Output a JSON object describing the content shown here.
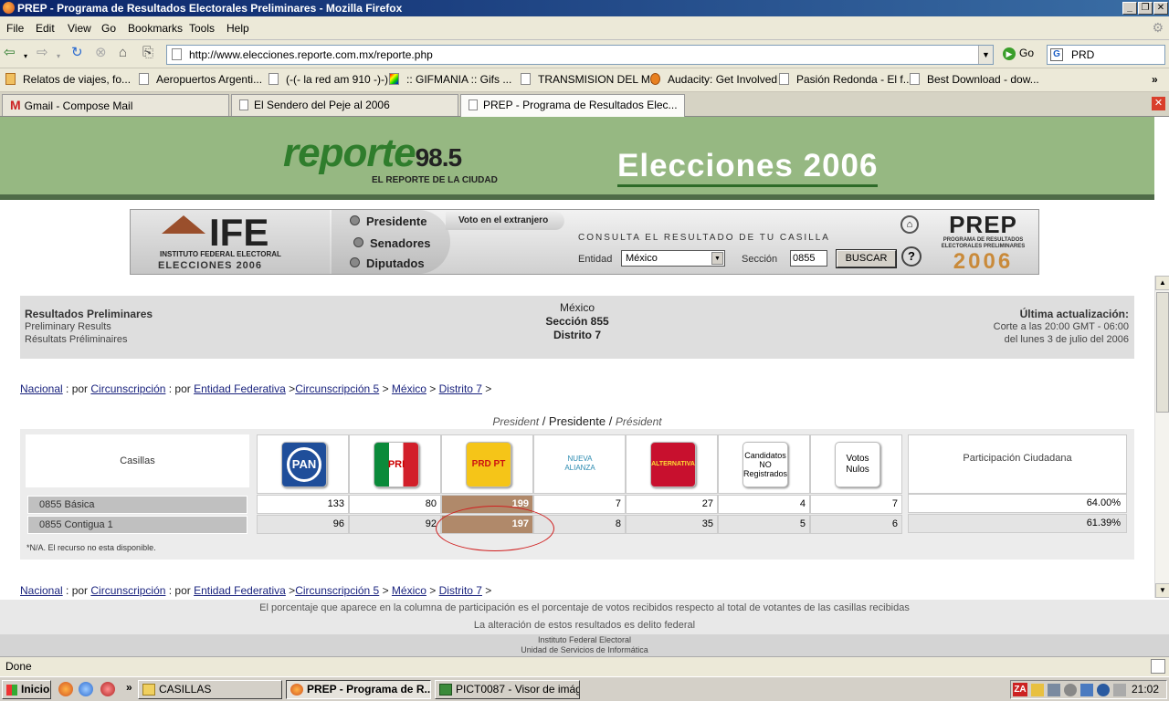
{
  "window": {
    "title": "PREP - Programa de Resultados Electorales Preliminares - Mozilla Firefox"
  },
  "menu": [
    "File",
    "Edit",
    "View",
    "Go",
    "Bookmarks",
    "Tools",
    "Help"
  ],
  "nav": {
    "url": "http://www.elecciones.reporte.com.mx/reporte.php",
    "go_label": "Go",
    "search_value": "PRD"
  },
  "bookmarks": [
    "Relatos de viajes, fo...",
    "Aeropuertos Argenti...",
    "(-(- la red am 910 -)-)",
    ":: GIFMANIA :: Gifs ...",
    "TRANSMISION DEL M...",
    "Audacity: Get Involved",
    "Pasión Redonda - El f...",
    "Best Download - dow..."
  ],
  "tabs": [
    "Gmail - Compose Mail",
    "El Sendero del Peje al 2006",
    "PREP - Programa de Resultados Elec..."
  ],
  "page": {
    "banner": {
      "logo_word": "reporte",
      "logo_num": "98.5",
      "logo_sub": "EL REPORTE DE LA CIUDAD",
      "title": "Elecciones 2006"
    },
    "ife": {
      "logo": "IFE",
      "logo_sub1": "INSTITUTO FEDERAL ELECTORAL",
      "logo_sub2": "ELECCIONES 2006",
      "menu": [
        "Presidente",
        "Senadores",
        "Diputados"
      ],
      "voto": "Voto en el extranjero",
      "consulta": "CONSULTA EL RESULTADO DE TU CASILLA",
      "entidad_label": "Entidad",
      "entidad_value": "México",
      "seccion_label": "Sección",
      "seccion_value": "0855",
      "buscar": "BUSCAR",
      "prep_title": "PREP",
      "prep_sub": "PROGRAMA DE RESULTADOS ELECTORALES PRELIMINARES",
      "prep_year": "2006"
    },
    "header": {
      "left": [
        "Resultados Preliminares",
        "Preliminary Results",
        "Résultats Préliminaires"
      ],
      "center": [
        "México",
        "Sección 855",
        "Distrito 7"
      ],
      "right": [
        "Última actualización:",
        "Corte a las 20:00 GMT - 06:00",
        "del lunes 3 de julio del 2006"
      ]
    },
    "breadcrumb": {
      "nacional": "Nacional",
      "sep1": " : por ",
      "circ": "Circunscripción",
      "sep2": " : por ",
      "entidad": "Entidad Federativa",
      "sep3": " >",
      "circ5": "Circunscripción 5",
      "sep4": " > ",
      "mexico": "México",
      "sep5": " > ",
      "distrito": "Distrito 7",
      "sep6": " >"
    },
    "president": {
      "es_i": "President",
      "sep": " / ",
      "main": "Presidente",
      "fr_i": "Président"
    },
    "table": {
      "casillas_label": "Casillas",
      "parties": [
        "PAN",
        "PRI",
        "PRD PT",
        "NUEVA ALIANZA",
        "ALTERNATIVA",
        "Candidatos NO Registrados",
        "Votos Nulos"
      ],
      "participacion_label": "Participación Ciudadana",
      "rows": [
        {
          "label": "0855 Básica",
          "values": [
            "133",
            "80",
            "199",
            "7",
            "27",
            "4",
            "7"
          ],
          "pct": "64.00%"
        },
        {
          "label": "0855 Contigua 1",
          "values": [
            "96",
            "92",
            "197",
            "8",
            "35",
            "5",
            "6"
          ],
          "pct": "61.39%"
        }
      ],
      "note": "*N/A. El recurso no esta disponible."
    },
    "footer": {
      "line1": "El porcentaje que aparece en la columna de participación es el porcentaje de votos recibidos respecto al total de votantes de las casillas recibidas",
      "line2": "La alteración de estos resultados es delito federal",
      "line3": "Instituto Federal Electoral",
      "line4": "Unidad de Servicios de Informática"
    }
  },
  "status": "Done",
  "taskbar": {
    "start": "Inicio",
    "items": [
      "CASILLAS",
      "PREP - Programa de R...",
      "PICT0087 - Visor de imág..."
    ],
    "clock": "21:02"
  },
  "colors": {
    "titlebar": "#0a246a",
    "banner": "#96b882",
    "winner_cell": "#b0896a",
    "annotation": "#d02020"
  }
}
